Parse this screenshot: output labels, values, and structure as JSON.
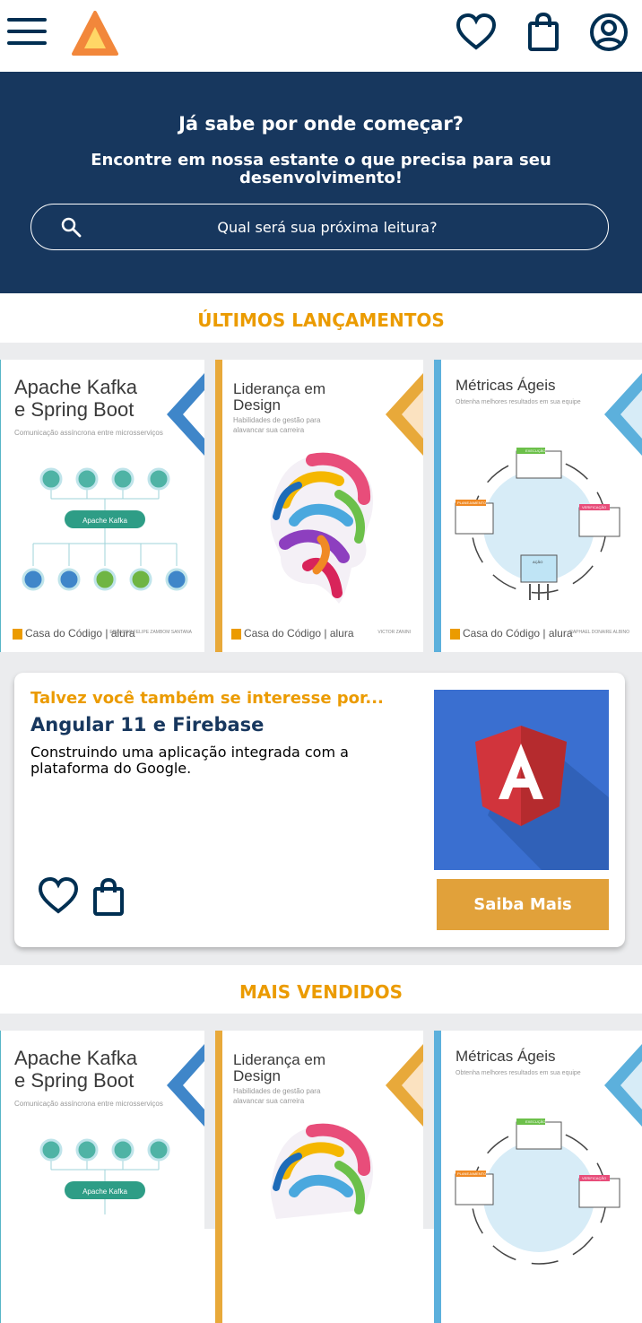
{
  "header": {
    "menu_icon": "hamburger-menu-icon",
    "logo_icon": "alura-logo-icon",
    "icons": [
      "heart-icon",
      "shopping-bag-icon",
      "user-account-icon"
    ]
  },
  "hero": {
    "title": "Já sabe por onde começar?",
    "subtitle": "Encontre em nossa estante o que precisa para seu desenvolvimento!",
    "search_placeholder": "Qual será sua próxima leitura?"
  },
  "sections": {
    "latest_title": "ÚLTIMOS LANÇAMENTOS",
    "bestsellers_title": "MAIS VENDIDOS"
  },
  "books": [
    {
      "title_line1": "Apache Kafka",
      "title_line2": "e Spring Boot",
      "subtitle": "Comunicação assíncrona entre microsserviços",
      "diagram_label": "Apache Kafka",
      "publisher": "Casa do Código | alura",
      "author": "EDUARDO FELIPE ZAMBOM SANTANA",
      "accent": "#3f86c9",
      "spine": "#57b6c7"
    },
    {
      "title_line1": "Liderança em",
      "title_line2": "Design",
      "subtitle": "Habilidades de gestão para alavancar sua carreira",
      "publisher": "Casa do Código | alura",
      "author": "VICTOR ZANINI",
      "accent": "#e8a93a",
      "spine": "#e8a93a"
    },
    {
      "title_line1": "Métricas Ágeis",
      "title_line2": "",
      "subtitle": "Obtenha melhores resultados em sua equipe",
      "labels": [
        "EXECUÇÃO",
        "PLANEJAMENTO",
        "VERIFICAÇÃO",
        "AÇÃO"
      ],
      "publisher": "Casa do Código | alura",
      "author": "RAPHAEL DONAIRE ALBINO",
      "accent": "#5cb0dc",
      "spine": "#5cb0dc"
    }
  ],
  "suggestion": {
    "kicker": "Talvez você também se interesse por...",
    "title": "Angular 11 e Firebase",
    "description": "Construindo uma aplicação integrada com a plataforma do Google.",
    "image_icon": "angular-logo-icon",
    "button_label": "Saiba Mais",
    "colors": {
      "button": "#e1a13a",
      "image_bg": "#3a6fd0",
      "shield": "#d1343c"
    }
  },
  "colors": {
    "navy": "#17375e",
    "gold": "#eb9b00",
    "shelf": "#ebecee"
  }
}
